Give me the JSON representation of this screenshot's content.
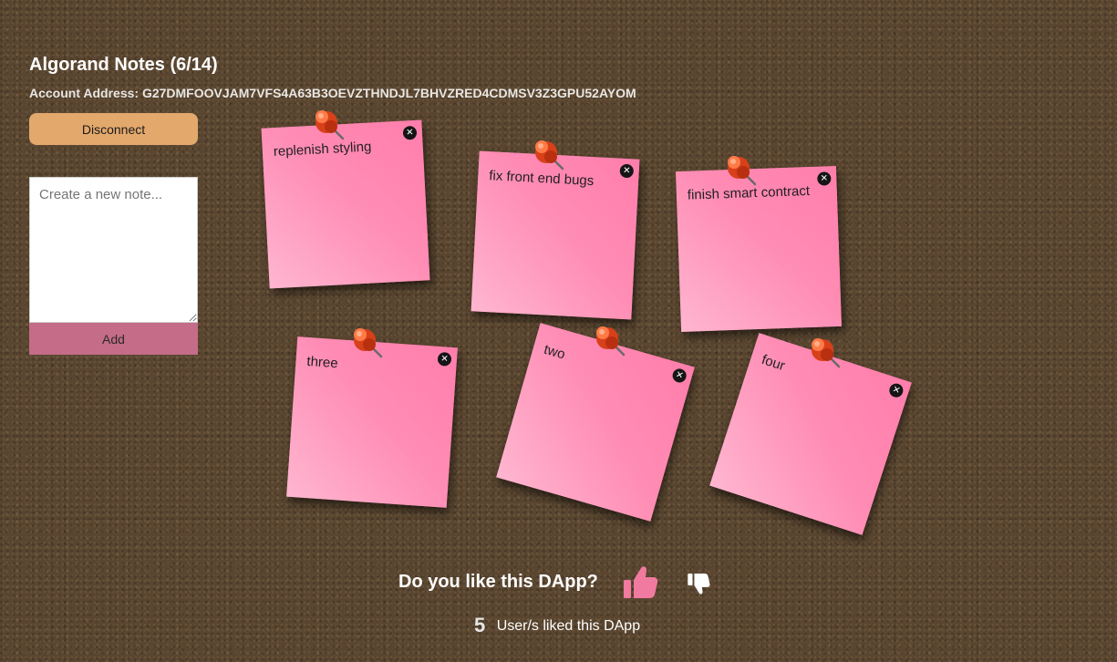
{
  "app": {
    "title": "Algorand Notes (6/14)",
    "account_label": "Account Address: G27DMFOOVJAM7VFS4A63B3OEVZTHNDJL7BHVZRED4CDMSV3Z3GPU52AYOM",
    "disconnect_label": "Disconnect"
  },
  "new_note": {
    "placeholder": "Create a new note...",
    "add_label": "Add"
  },
  "notes": [
    {
      "text": "replenish styling"
    },
    {
      "text": "fix front end bugs"
    },
    {
      "text": "finish smart contract"
    },
    {
      "text": "three"
    },
    {
      "text": "two"
    },
    {
      "text": "four"
    }
  ],
  "feedback": {
    "question": "Do you like this DApp?",
    "like_count": "5",
    "like_count_label": "User/s liked this DApp"
  },
  "icons": {
    "pin": "pushpin-icon",
    "delete": "close-icon",
    "like": "thumbs-up-icon",
    "dislike": "thumbs-down-icon"
  },
  "colors": {
    "board": "#5a4630",
    "note": "#ff8cb4",
    "disconnect_button": "#e3a86c",
    "add_button": "#c46c88",
    "like_icon": "#f07aa0",
    "pin": "#e2461a"
  }
}
